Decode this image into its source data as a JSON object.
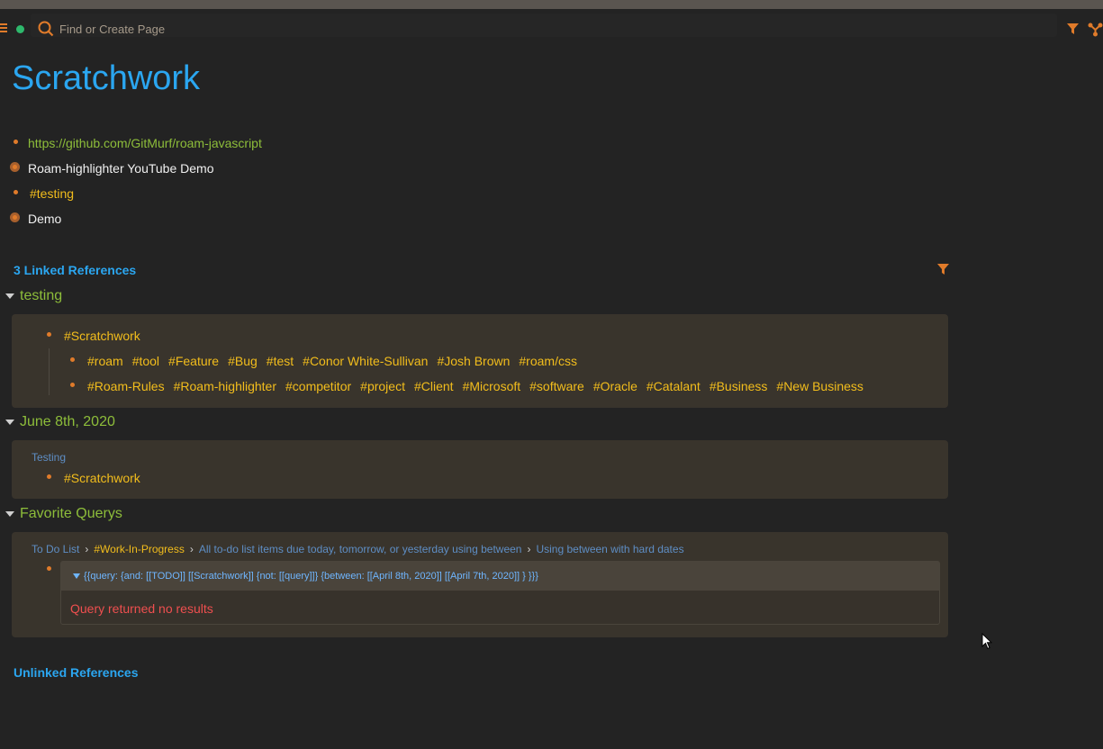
{
  "search": {
    "placeholder": "Find or Create Page"
  },
  "page": {
    "title": "Scratchwork"
  },
  "blocks": [
    {
      "text": "https://github.com/GitMurf/roam-javascript"
    },
    {
      "text": "Roam-highlighter YouTube Demo"
    },
    {
      "text": "#testing"
    },
    {
      "text": "Demo"
    }
  ],
  "linked_refs": {
    "heading": "3 Linked References",
    "groups": [
      {
        "title": "testing",
        "parent_tag": "#Scratchwork",
        "row1": [
          "#roam",
          "#tool",
          "#Feature",
          "#Bug",
          "#test",
          "#Conor White-Sullivan",
          "#Josh Brown",
          "#roam/css"
        ],
        "row2": [
          "#Roam-Rules",
          "#Roam-highlighter",
          "#competitor",
          "#project",
          "#Client",
          "#Microsoft",
          "#software",
          "#Oracle",
          "#Catalant",
          "#Business",
          "#New Business"
        ]
      },
      {
        "title": "June 8th, 2020",
        "breadcrumb": "Testing",
        "tag": "#Scratchwork"
      },
      {
        "title": "Favorite Querys",
        "breadcrumb": [
          "To Do List",
          "#Work-In-Progress",
          "All to-do list items due today, tomorrow, or yesterday using between",
          "Using between with hard dates"
        ],
        "query": "{{query:  {and: [[TODO]] [[Scratchwork]] {not: [[query]]} {between: [[April 8th, 2020]] [[April 7th, 2020]] } }}}",
        "result": "Query returned no results"
      }
    ]
  },
  "unlinked_refs": {
    "heading": "Unlinked References"
  },
  "colors": {
    "background": "#232323",
    "title_blue": "#2ba6f0",
    "link_green": "#8dbd3a",
    "tag_yellow": "#f2bd1c",
    "bullet_orange": "#e07b2a",
    "card_bg": "#39342c",
    "error_red": "#ef4f4f"
  },
  "icons": [
    "menu-icon",
    "sync-status-icon",
    "search-icon",
    "filter-icon",
    "graph-icon",
    "caret-down-icon",
    "mouse-cursor-icon"
  ]
}
